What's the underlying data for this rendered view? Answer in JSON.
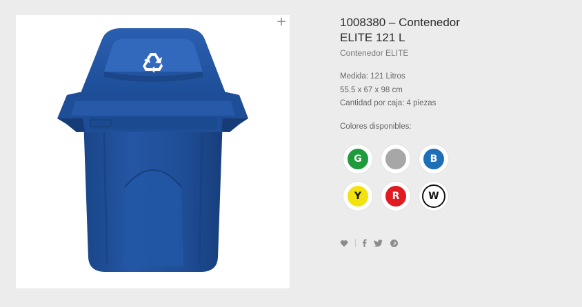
{
  "product": {
    "title": "1008380 – Contenedor\nELITE 121 L",
    "subtitle": "Contenedor ELITE",
    "specs": [
      "Medida: 121 Litros",
      "55.5 x 67 x 98 cm",
      "Cantidad por caja: 4 piezas"
    ],
    "colors_label": "Colores disponibles:",
    "colors": [
      {
        "letter": "G",
        "name": "green",
        "color": "#1f9a3c",
        "text_color": "#ffffff"
      },
      {
        "letter": "",
        "name": "gray",
        "color": "#a7a7a7",
        "text_color": "#ffffff"
      },
      {
        "letter": "B",
        "name": "blue",
        "color": "#1e6fb8",
        "text_color": "#ffffff"
      },
      {
        "letter": "Y",
        "name": "yellow",
        "color": "#f2e20f",
        "text_color": "#111111"
      },
      {
        "letter": "R",
        "name": "red",
        "color": "#e01b22",
        "text_color": "#ffffff"
      },
      {
        "letter": "W",
        "name": "white",
        "color": "#ffffff",
        "text_color": "#111111"
      }
    ]
  },
  "image": {
    "zoom_label": "+",
    "product_color": "#1d4f99"
  },
  "actions": {
    "icons": [
      "heart-icon",
      "facebook-icon",
      "twitter-icon",
      "pinterest-icon"
    ]
  }
}
